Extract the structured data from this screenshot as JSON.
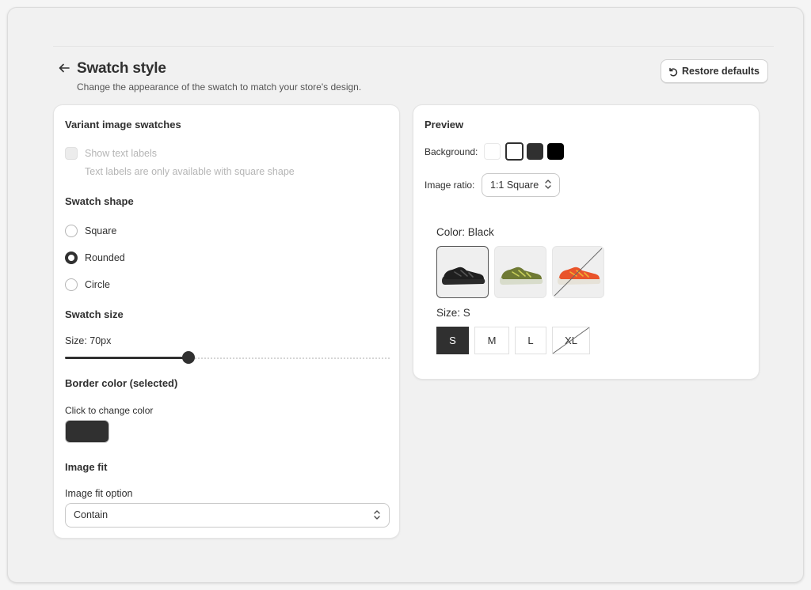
{
  "header": {
    "title": "Swatch style",
    "subtitle": "Change the appearance of the swatch to match your store's design.",
    "restore_label": "Restore defaults"
  },
  "settings": {
    "section_title": "Variant image swatches",
    "show_text_labels": {
      "label": "Show text labels",
      "help": "Text labels are only available with square shape",
      "checked": false,
      "disabled": true
    },
    "shape": {
      "heading": "Swatch shape",
      "options": [
        "Square",
        "Rounded",
        "Circle"
      ],
      "selected": "Rounded"
    },
    "size": {
      "heading": "Swatch size",
      "label": "Size: 70px",
      "fraction": 0.38
    },
    "border": {
      "heading": "Border color (selected)",
      "label": "Click to change color",
      "color": "#303030"
    },
    "image_fit": {
      "heading": "Image fit",
      "label": "Image fit option",
      "value": "Contain"
    }
  },
  "preview": {
    "title": "Preview",
    "background_label": "Background:",
    "background_options": [
      "#ffffff",
      "#ffffff",
      "#303030",
      "#000000"
    ],
    "background_selected_index": 1,
    "ratio_label": "Image ratio:",
    "ratio_value": "1:1 Square",
    "color_label": "Color: Black",
    "color_swatches": [
      {
        "color": "black",
        "shoe": "#1f1f1f",
        "accent": "#555555",
        "sole": "#2a2a2a",
        "selected": true,
        "unavailable": false
      },
      {
        "color": "olive",
        "shoe": "#6f7a34",
        "accent": "#c8d05a",
        "sole": "#d8dccb",
        "selected": false,
        "unavailable": false
      },
      {
        "color": "orange",
        "shoe": "#e9542b",
        "accent": "#f1b030",
        "sole": "#e6e2d8",
        "selected": false,
        "unavailable": true
      }
    ],
    "size_label": "Size: S",
    "sizes": [
      {
        "label": "S",
        "selected": true,
        "unavailable": false
      },
      {
        "label": "M",
        "selected": false,
        "unavailable": false
      },
      {
        "label": "L",
        "selected": false,
        "unavailable": false
      },
      {
        "label": "XL",
        "selected": false,
        "unavailable": true
      }
    ]
  },
  "colors": {
    "primary": "#303030",
    "muted": "#b5b5b5"
  }
}
